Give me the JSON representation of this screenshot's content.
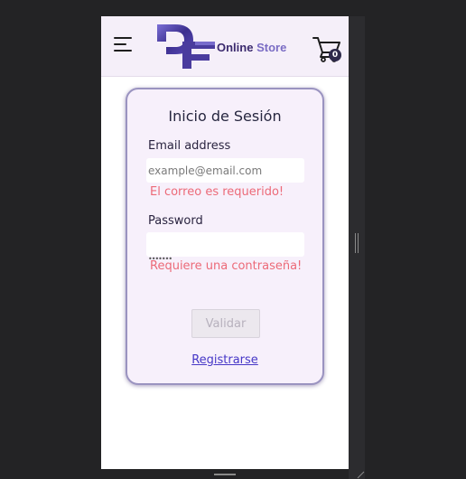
{
  "header": {
    "logo_word1": "Online",
    "logo_word2": "Store",
    "cart_count": "0"
  },
  "login": {
    "title": "Inicio de Sesión",
    "email_label": "Email address",
    "email_placeholder": "example@email.com",
    "email_value": "",
    "email_error": "El correo es requerido!",
    "password_label": "Password",
    "password_value": "•••••••",
    "password_error": "Requiere una contraseña!",
    "submit_label": "Validar",
    "register_link": "Registrarse"
  },
  "colors": {
    "header_bg": "#f5eff9",
    "card_bg": "#f7f0fb",
    "card_border": "#9a93c0",
    "error": "#ec6a78",
    "link": "#4637c7",
    "logo_dark": "#3b2a6e",
    "logo_light": "#7a6cc4"
  },
  "icons": [
    "menu-icon",
    "logo-mark-icon",
    "cart-icon"
  ]
}
